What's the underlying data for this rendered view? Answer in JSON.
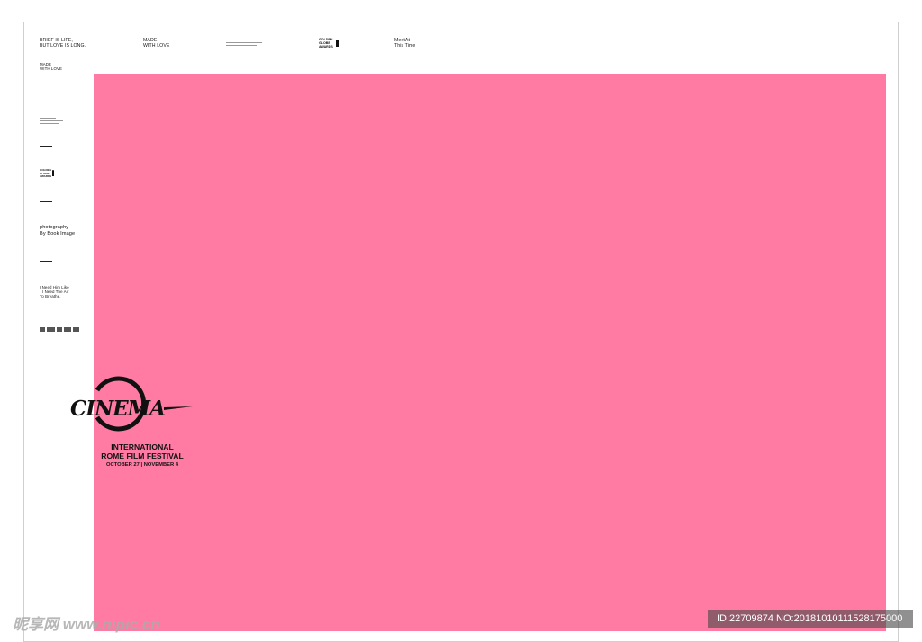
{
  "colors": {
    "background": "#ffffff",
    "panel": "#ff7ba4",
    "ink": "#111111",
    "watermark_band": "#5a5a5a"
  },
  "top_row": {
    "item1_line1": "BRIEF IS LIFE,",
    "item1_line2": "BUT LOVE IS LONG.",
    "item2_line1": "MADE",
    "item2_line2": "WITH LOVE",
    "item3_line1": "GOLDEN",
    "item3_line2": "GLOBE",
    "item3_line3": "AWARDS",
    "item4_line1": "MeetAt",
    "item4_line2": "This Time"
  },
  "sidebar": {
    "made_line1": "MADE",
    "made_line2": "WITH LOVE",
    "globe_line1": "GOLDEN",
    "globe_line2": "GLOBE",
    "globe_line3": "AWARDS",
    "photo_line1": "photography",
    "photo_line2": "By Book Image",
    "lyric_line1": "I Need Him Like",
    "lyric_line2": "I Need The Air",
    "lyric_line3": "To Breathe."
  },
  "festival": {
    "logo_word": "CINEMA",
    "line1": "INTERNATIONAL",
    "line2": "ROME FILM FESTIVAL",
    "dates": "OCTOBER 27 | NOVEMBER 4"
  },
  "watermark": {
    "left": "昵享网 www.nipic.cn",
    "right": "ID:22709874 NO:20181010111528175000"
  }
}
